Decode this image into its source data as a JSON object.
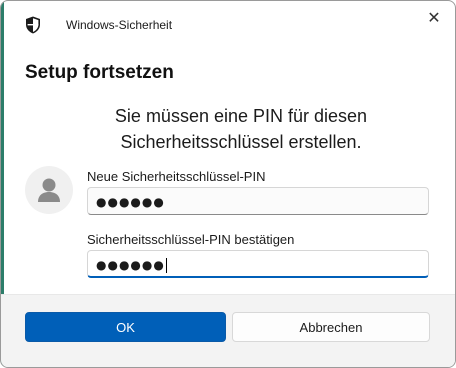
{
  "titlebar": {
    "app_title": "Windows-Sicherheit",
    "icon": "shield-icon",
    "close_label": "✕"
  },
  "dialog": {
    "title": "Setup fortsetzen",
    "message_line1": "Sie müssen eine PIN für diesen",
    "message_line2": "Sicherheitsschlüssel erstellen."
  },
  "fields": {
    "new_pin": {
      "label": "Neue Sicherheitsschlüssel-PIN",
      "value": "●●●●●●"
    },
    "confirm_pin": {
      "label": "Sicherheitsschlüssel-PIN bestätigen",
      "value": "●●●●●●"
    }
  },
  "buttons": {
    "ok_label": "OK",
    "cancel_label": "Abbrechen"
  },
  "colors": {
    "accent": "#005fb8",
    "footer_bg": "#f3f3f3",
    "side_strip": "#2d7d6a"
  }
}
